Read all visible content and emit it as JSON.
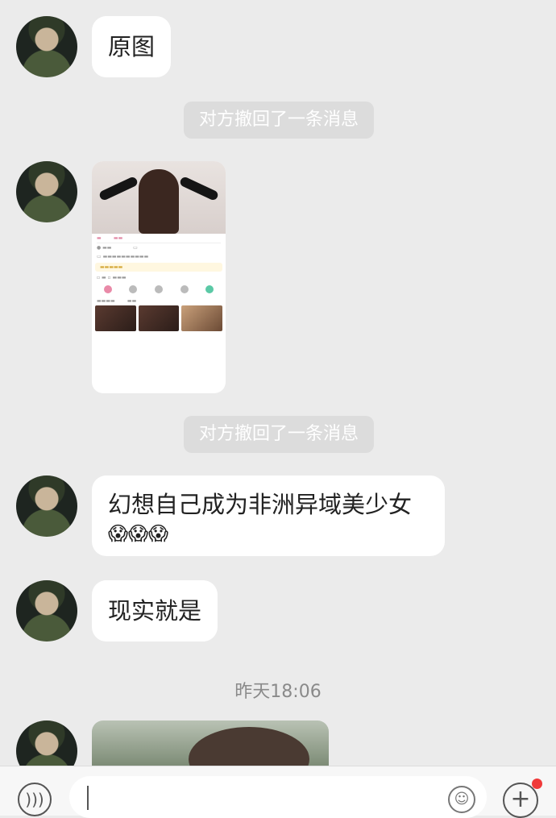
{
  "messages": {
    "m1": "原图",
    "system1": "对方撤回了一条消息",
    "system2": "对方撤回了一条消息",
    "m2_line1": "幻想自己成为非洲异域美少女",
    "m2_emoji": "😱😱😱",
    "m3": "现实就是",
    "timestamp": "昨天18:06"
  },
  "input": {
    "voice_icon": "voice-icon",
    "emoji_icon": "smiley-icon",
    "plus_icon": "plus-icon",
    "unread_dot_color": "#f03a3a"
  }
}
